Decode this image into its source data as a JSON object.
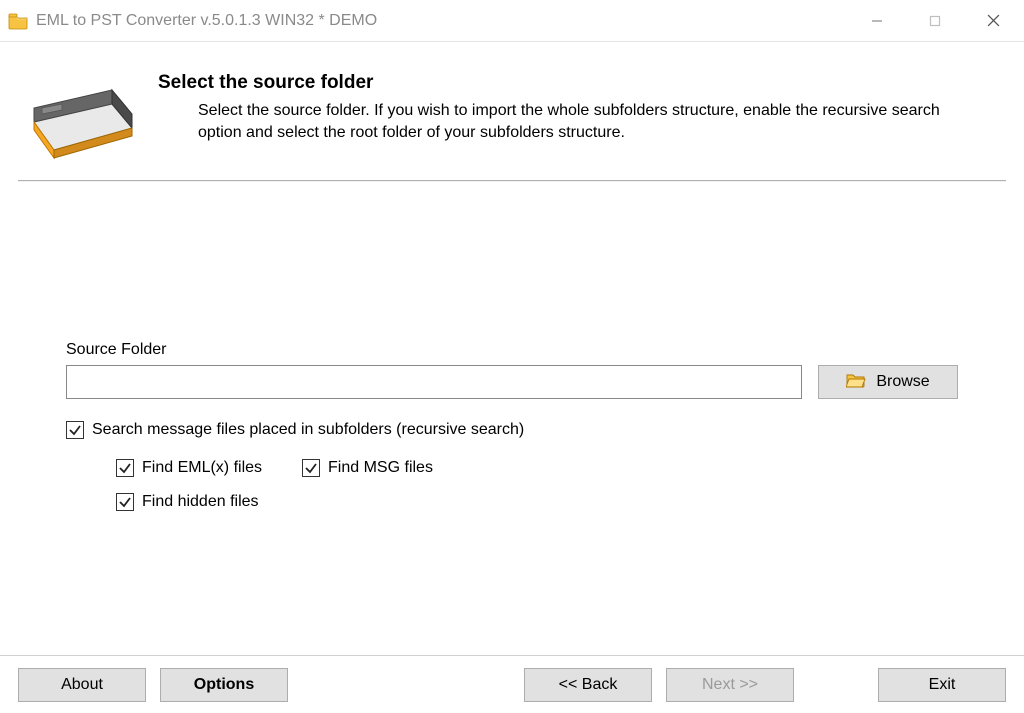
{
  "window": {
    "title": "EML to PST Converter v.5.0.1.3 WIN32 * DEMO"
  },
  "header": {
    "title": "Select the source folder",
    "description": "Select the source folder. If you wish to import the whole subfolders structure, enable the recursive search option and select the root folder of your subfolders structure."
  },
  "form": {
    "source_label": "Source Folder",
    "source_value": "",
    "browse_label": "Browse",
    "recursive_label": "Search message files placed in subfolders (recursive search)",
    "recursive_checked": true,
    "find_eml_label": "Find EML(x) files",
    "find_eml_checked": true,
    "find_msg_label": "Find MSG files",
    "find_msg_checked": true,
    "find_hidden_label": "Find hidden files",
    "find_hidden_checked": true
  },
  "footer": {
    "about": "About",
    "options": "Options",
    "back": "<< Back",
    "next": "Next >>",
    "exit": "Exit",
    "next_enabled": false
  }
}
